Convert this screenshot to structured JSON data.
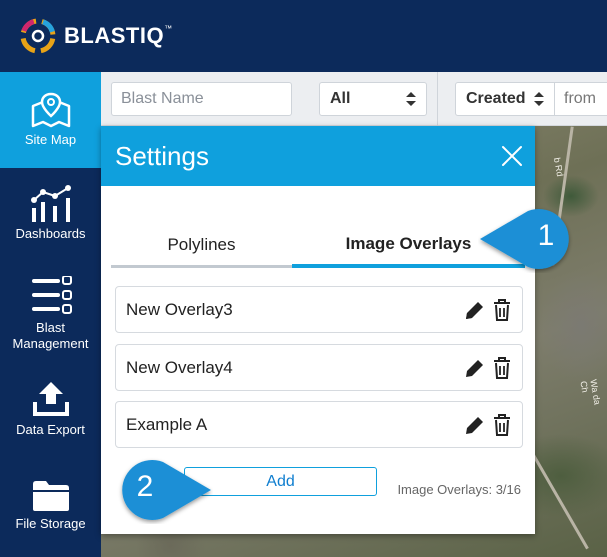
{
  "app": {
    "logo_text": "BLAST",
    "logo_text_suffix": "IQ",
    "logo_tm": "™"
  },
  "sidebar": {
    "items": [
      {
        "label": "Site Map",
        "icon": "map-pin-icon"
      },
      {
        "label": "Dashboards",
        "icon": "chart-icon"
      },
      {
        "label": "Blast Management",
        "icon": "list-icon"
      },
      {
        "label": "Data Export",
        "icon": "upload-icon"
      },
      {
        "label": "File Storage",
        "icon": "folder-icon"
      }
    ]
  },
  "filters": {
    "blast_name_placeholder": "Blast Name",
    "type_value": "All",
    "sort_value": "Created",
    "from_label": "from"
  },
  "map": {
    "road_label_1": "b Rd",
    "road_label_2": "Wa da Ch"
  },
  "settings": {
    "title": "Settings",
    "tabs": [
      {
        "label": "Polylines",
        "active": false
      },
      {
        "label": "Image Overlays",
        "active": true
      }
    ],
    "overlays": [
      "New Overlay3",
      "New Overlay4",
      "Example A"
    ],
    "add_label": "Add",
    "count_text": "Image Overlays: 3/16"
  },
  "callouts": {
    "one": "1",
    "two": "2"
  },
  "colors": {
    "accent": "#0fa0dd",
    "navy": "#0c2a5b",
    "callout": "#1a8fd6"
  }
}
